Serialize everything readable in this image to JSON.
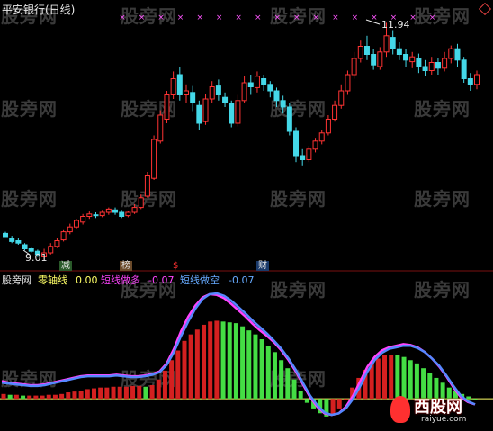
{
  "upper_panel": {
    "title": "平安银行(日线)",
    "high_label": "11.94",
    "low_label": "9.01",
    "event_tags": [
      {
        "text": "减",
        "color": "#e6e6e6",
        "bg": "#2a5a2a"
      },
      {
        "text": "榜",
        "color": "#e6e6e6",
        "bg": "#6a4a2a"
      },
      {
        "text": "$",
        "color": "#ff3030",
        "bg": "#000000"
      },
      {
        "text": "财",
        "color": "#e6e6e6",
        "bg": "#1a3a6a"
      }
    ]
  },
  "lower_panel": {
    "watermark_label": "股旁网",
    "indicators": [
      {
        "name": "零轴线",
        "value": "0.00",
        "color": "#ffff66"
      },
      {
        "name": "短线做多",
        "value": "-0.07",
        "color": "#ff44ff"
      },
      {
        "name": "短线做空",
        "value": "-0.07",
        "color": "#66aaff"
      }
    ]
  },
  "watermark": {
    "text": "股旁网"
  },
  "logo": {
    "text": "西股网",
    "url_text": "raiyue.com"
  },
  "colors": {
    "up": "#ff3333",
    "down": "#44d8e8",
    "bar_up": "#d42020",
    "bar_down": "#44dd44",
    "ma_pink": "#ff44ff",
    "ma_blue": "#5588ff",
    "zero": "#ffff66",
    "divider": "#7a1010"
  },
  "chart_data": [
    {
      "type": "candlestick",
      "title": "平安银行(日线)",
      "ylim": [
        9.0,
        12.0
      ],
      "candles": [
        [
          9.34,
          9.3,
          9.3,
          9.36
        ],
        [
          9.28,
          9.24,
          9.22,
          9.31
        ],
        [
          9.25,
          9.22,
          9.2,
          9.28
        ],
        [
          9.2,
          9.15,
          9.13,
          9.22
        ],
        [
          9.15,
          9.12,
          9.1,
          9.17
        ],
        [
          9.12,
          9.08,
          9.05,
          9.14
        ],
        [
          9.05,
          9.1,
          9.01,
          9.15
        ],
        [
          9.1,
          9.18,
          9.08,
          9.22
        ],
        [
          9.18,
          9.25,
          9.16,
          9.28
        ],
        [
          9.26,
          9.36,
          9.24,
          9.38
        ],
        [
          9.36,
          9.42,
          9.33,
          9.46
        ],
        [
          9.42,
          9.5,
          9.4,
          9.52
        ],
        [
          9.48,
          9.55,
          9.45,
          9.58
        ],
        [
          9.55,
          9.58,
          9.52,
          9.61
        ],
        [
          9.57,
          9.56,
          9.53,
          9.6
        ],
        [
          9.56,
          9.6,
          9.54,
          9.63
        ],
        [
          9.6,
          9.64,
          9.57,
          9.66
        ],
        [
          9.63,
          9.6,
          9.57,
          9.66
        ],
        [
          9.6,
          9.55,
          9.53,
          9.63
        ],
        [
          9.56,
          9.6,
          9.54,
          9.62
        ],
        [
          9.6,
          9.66,
          9.58,
          9.7
        ],
        [
          9.66,
          9.78,
          9.64,
          9.82
        ],
        [
          9.8,
          10.05,
          9.78,
          10.1
        ],
        [
          10.02,
          10.5,
          10.0,
          10.55
        ],
        [
          10.48,
          10.8,
          10.45,
          10.86
        ],
        [
          10.75,
          11.05,
          10.7,
          11.1
        ],
        [
          11.05,
          11.25,
          11.0,
          11.34
        ],
        [
          11.3,
          11.05,
          10.98,
          11.4
        ],
        [
          11.05,
          11.1,
          10.95,
          11.18
        ],
        [
          11.08,
          10.95,
          10.85,
          11.16
        ],
        [
          10.92,
          10.7,
          10.62,
          10.98
        ],
        [
          10.72,
          11.0,
          10.68,
          11.06
        ],
        [
          11.0,
          11.15,
          10.95,
          11.22
        ],
        [
          11.16,
          11.05,
          10.98,
          11.24
        ],
        [
          11.02,
          10.95,
          10.9,
          11.08
        ],
        [
          10.95,
          10.7,
          10.65,
          10.98
        ],
        [
          10.7,
          10.98,
          10.66,
          11.05
        ],
        [
          10.98,
          11.2,
          10.95,
          11.28
        ],
        [
          11.2,
          11.15,
          11.05,
          11.3
        ],
        [
          11.14,
          11.28,
          11.08,
          11.34
        ],
        [
          11.25,
          11.18,
          11.1,
          11.3
        ],
        [
          11.18,
          11.1,
          11.02,
          11.22
        ],
        [
          11.1,
          10.98,
          10.9,
          11.14
        ],
        [
          10.98,
          10.9,
          10.82,
          11.04
        ],
        [
          10.9,
          10.6,
          10.55,
          10.95
        ],
        [
          10.6,
          10.3,
          10.22,
          10.65
        ],
        [
          10.3,
          10.25,
          10.18,
          10.38
        ],
        [
          10.25,
          10.38,
          10.22,
          10.42
        ],
        [
          10.38,
          10.48,
          10.34,
          10.52
        ],
        [
          10.48,
          10.58,
          10.44,
          10.62
        ],
        [
          10.58,
          10.75,
          10.55,
          10.8
        ],
        [
          10.75,
          10.92,
          10.72,
          10.98
        ],
        [
          10.92,
          11.1,
          10.88,
          11.18
        ],
        [
          11.1,
          11.3,
          11.05,
          11.35
        ],
        [
          11.3,
          11.5,
          11.25,
          11.58
        ],
        [
          11.5,
          11.65,
          11.45,
          11.72
        ],
        [
          11.65,
          11.55,
          11.48,
          11.78
        ],
        [
          11.55,
          11.42,
          11.36,
          11.62
        ],
        [
          11.4,
          11.58,
          11.36,
          11.64
        ],
        [
          11.58,
          11.78,
          11.52,
          11.94
        ],
        [
          11.76,
          11.62,
          11.55,
          11.85
        ],
        [
          11.62,
          11.55,
          11.48,
          11.7
        ],
        [
          11.55,
          11.48,
          11.4,
          11.62
        ],
        [
          11.46,
          11.52,
          11.38,
          11.58
        ],
        [
          11.5,
          11.4,
          11.32,
          11.56
        ],
        [
          11.4,
          11.35,
          11.28,
          11.48
        ],
        [
          11.35,
          11.45,
          11.3,
          11.52
        ],
        [
          11.45,
          11.38,
          11.3,
          11.5
        ],
        [
          11.38,
          11.5,
          11.34,
          11.58
        ],
        [
          11.5,
          11.62,
          11.44,
          11.66
        ],
        [
          11.62,
          11.48,
          11.4,
          11.68
        ],
        [
          11.48,
          11.25,
          11.2,
          11.52
        ],
        [
          11.25,
          11.18,
          11.1,
          11.32
        ],
        [
          11.18,
          11.3,
          11.12,
          11.35
        ]
      ],
      "signal_marks": "pink crosses along top row"
    },
    {
      "type": "bar",
      "title": "",
      "ylim": [
        -0.3,
        1.4
      ],
      "values": [
        0.06,
        0.05,
        0.05,
        0.04,
        0.04,
        0.04,
        0.04,
        0.05,
        0.05,
        0.06,
        0.08,
        0.09,
        0.1,
        0.12,
        0.13,
        0.14,
        0.14,
        0.15,
        0.15,
        0.15,
        0.16,
        0.16,
        0.15,
        0.17,
        0.24,
        0.35,
        0.48,
        0.6,
        0.72,
        0.8,
        0.86,
        0.92,
        0.96,
        0.97,
        0.96,
        0.95,
        0.94,
        0.9,
        0.85,
        0.8,
        0.74,
        0.66,
        0.58,
        0.48,
        0.38,
        0.24,
        0.1,
        -0.05,
        -0.12,
        -0.18,
        -0.22,
        -0.2,
        -0.12,
        0.0,
        0.14,
        0.26,
        0.36,
        0.44,
        0.5,
        0.54,
        0.55,
        0.54,
        0.52,
        0.48,
        0.44,
        0.38,
        0.32,
        0.26,
        0.2,
        0.14,
        0.1,
        0.06,
        0.03,
        -0.02
      ],
      "series": [
        {
          "name": "短线做多",
          "values": [
            0.22,
            0.2,
            0.19,
            0.18,
            0.17,
            0.17,
            0.18,
            0.2,
            0.22,
            0.24,
            0.26,
            0.28,
            0.29,
            0.29,
            0.29,
            0.29,
            0.3,
            0.29,
            0.28,
            0.28,
            0.29,
            0.31,
            0.34,
            0.44,
            0.62,
            0.84,
            1.02,
            1.16,
            1.26,
            1.3,
            1.29,
            1.25,
            1.18,
            1.1,
            1.02,
            0.93,
            0.85,
            0.78,
            0.7,
            0.6,
            0.48,
            0.34,
            0.18,
            0.02,
            -0.1,
            -0.18,
            -0.2,
            -0.18,
            -0.1,
            0.04,
            0.22,
            0.4,
            0.52,
            0.6,
            0.64,
            0.66,
            0.68,
            0.67,
            0.64,
            0.58,
            0.5,
            0.4,
            0.28,
            0.14,
            0.02,
            -0.04,
            -0.07
          ]
        },
        {
          "name": "短线做空",
          "values": [
            0.2,
            0.19,
            0.18,
            0.17,
            0.16,
            0.16,
            0.17,
            0.19,
            0.21,
            0.23,
            0.25,
            0.27,
            0.28,
            0.28,
            0.28,
            0.28,
            0.29,
            0.28,
            0.27,
            0.27,
            0.28,
            0.3,
            0.33,
            0.42,
            0.58,
            0.78,
            0.96,
            1.12,
            1.24,
            1.3,
            1.31,
            1.28,
            1.22,
            1.14,
            1.06,
            0.97,
            0.89,
            0.81,
            0.72,
            0.62,
            0.5,
            0.36,
            0.2,
            0.04,
            -0.08,
            -0.17,
            -0.2,
            -0.18,
            -0.12,
            0.0,
            0.16,
            0.34,
            0.48,
            0.57,
            0.62,
            0.64,
            0.66,
            0.66,
            0.63,
            0.58,
            0.5,
            0.41,
            0.29,
            0.16,
            0.04,
            -0.03,
            -0.07
          ]
        }
      ]
    }
  ]
}
